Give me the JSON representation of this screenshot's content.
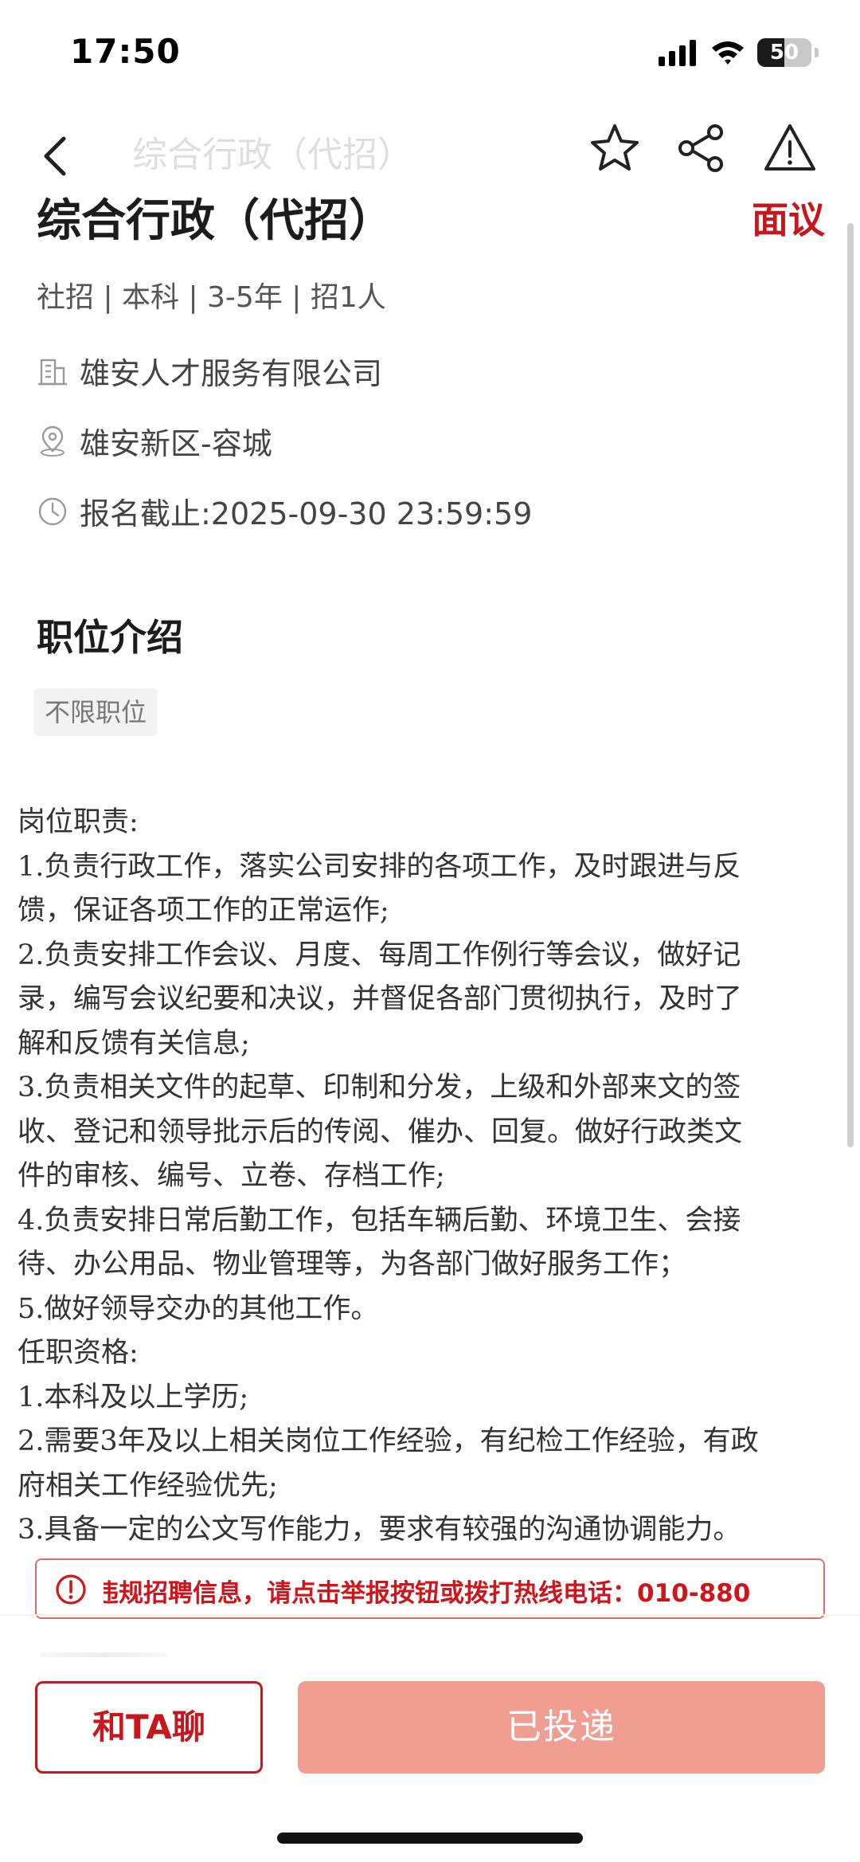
{
  "status_bar": {
    "time": "17:50",
    "battery": "50",
    "icons": [
      "cellular-signal-icon",
      "wifi-icon",
      "battery-icon"
    ]
  },
  "nav": {
    "title": "综合行政（代招）",
    "icons": [
      "back-arrow-icon",
      "star-icon",
      "share-icon",
      "warning-icon"
    ]
  },
  "job": {
    "title": "综合行政（代招）",
    "salary": "面议",
    "meta": "社招 | 本科 | 3-5年 | 招1人",
    "company": "雄安人才服务有限公司",
    "location": "雄安新区-容城",
    "deadline": "报名截止:2025-09-30 23:59:59"
  },
  "section": {
    "title": "职位介绍",
    "tag": "不限职位"
  },
  "description": {
    "lines": [
      "岗位职责:",
      "1.负责行政工作，落实公司安排的各项工作，及时跟进与反",
      "馈，保证各项工作的正常运作;",
      "2.负责安排工作会议、月度、每周工作例行等会议，做好记",
      "录，编写会议纪要和决议，并督促各部门贯彻执行，及时了",
      "解和反馈有关信息;",
      "3.负责相关文件的起草、印制和分发，上级和外部来文的签",
      "收、登记和领导批示后的传阅、催办、回复。做好行政类文",
      "件的审核、编号、立卷、存档工作;",
      "4.负责安排日常后勤工作，包括车辆后勤、环境卫生、会接",
      "待、办公用品、物业管理等，为各部门做好服务工作；",
      "5.做好领导交办的其他工作。",
      "任职资格:",
      "1.本科及以上学历;",
      "2.需要3年及以上相关岗位工作经验，有纪检工作经验，有政",
      "府相关工作经验优先;",
      "3.具备一定的公文写作能力，要求有较强的沟通协调能力。"
    ]
  },
  "notice": {
    "text": "违规招聘信息，请点击举报按钮或拨打热线电话：010-880"
  },
  "actions": {
    "chat_label": "和TA聊",
    "applied_label": "已投递"
  },
  "colors": {
    "brand_red": "#c7161d",
    "applied_button": "#f09e92",
    "notice_border": "#e06b6b"
  }
}
